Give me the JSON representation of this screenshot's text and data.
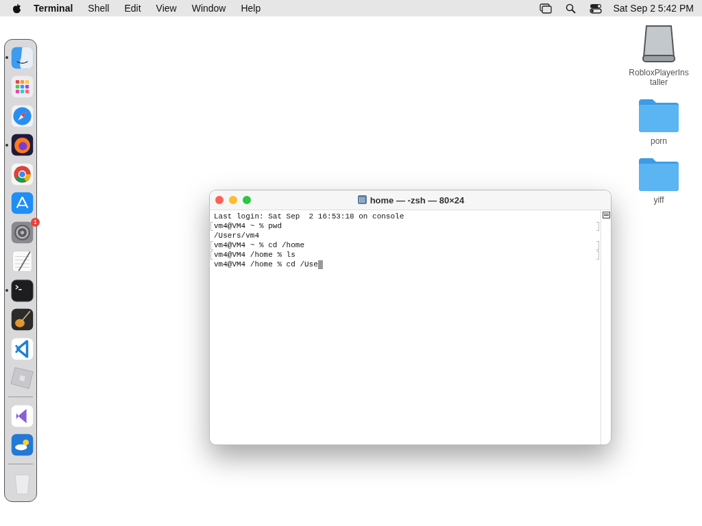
{
  "menu_bar": {
    "app_name": "Terminal",
    "menus": [
      "Shell",
      "Edit",
      "View",
      "Window",
      "Help"
    ],
    "clock": "Sat Sep 2  5:42 PM"
  },
  "dock": {
    "items": [
      {
        "kind": "finder",
        "running": true
      },
      {
        "kind": "launchpad",
        "running": false
      },
      {
        "kind": "safari",
        "running": false
      },
      {
        "kind": "firefox",
        "running": true
      },
      {
        "kind": "chrome",
        "running": false
      },
      {
        "kind": "appstore",
        "running": false
      },
      {
        "kind": "settings",
        "running": false,
        "badge": "1"
      },
      {
        "kind": "textedit",
        "running": false
      },
      {
        "kind": "terminal",
        "running": true
      },
      {
        "kind": "garageband",
        "running": false
      },
      {
        "kind": "vscode",
        "running": false
      },
      {
        "kind": "roblox",
        "running": false
      },
      {
        "kind": "divider"
      },
      {
        "kind": "visualstudio",
        "running": false
      },
      {
        "kind": "weather",
        "running": false
      },
      {
        "kind": "divider"
      },
      {
        "kind": "trash",
        "running": false
      }
    ]
  },
  "desktop_icons": [
    {
      "kind": "drive",
      "label": "RobloxPlayerInstaller"
    },
    {
      "kind": "folder",
      "label": "porn"
    },
    {
      "kind": "folder",
      "label": "yiff"
    }
  ],
  "terminal": {
    "title": "home — -zsh — 80×24",
    "lines": [
      {
        "text": "Last login: Sat Sep  2 16:53:18 on console",
        "marked": false,
        "cursor": false
      },
      {
        "text": "vm4@VM4 ~ % pwd",
        "marked": true,
        "cursor": false
      },
      {
        "text": "/Users/vm4",
        "marked": false,
        "cursor": false
      },
      {
        "text": "vm4@VM4 ~ % cd /home",
        "marked": true,
        "cursor": false
      },
      {
        "text": "vm4@VM4 /home % ls",
        "marked": true,
        "cursor": false
      },
      {
        "text": "vm4@VM4 /home % cd /Use",
        "marked": false,
        "cursor": true
      }
    ]
  }
}
